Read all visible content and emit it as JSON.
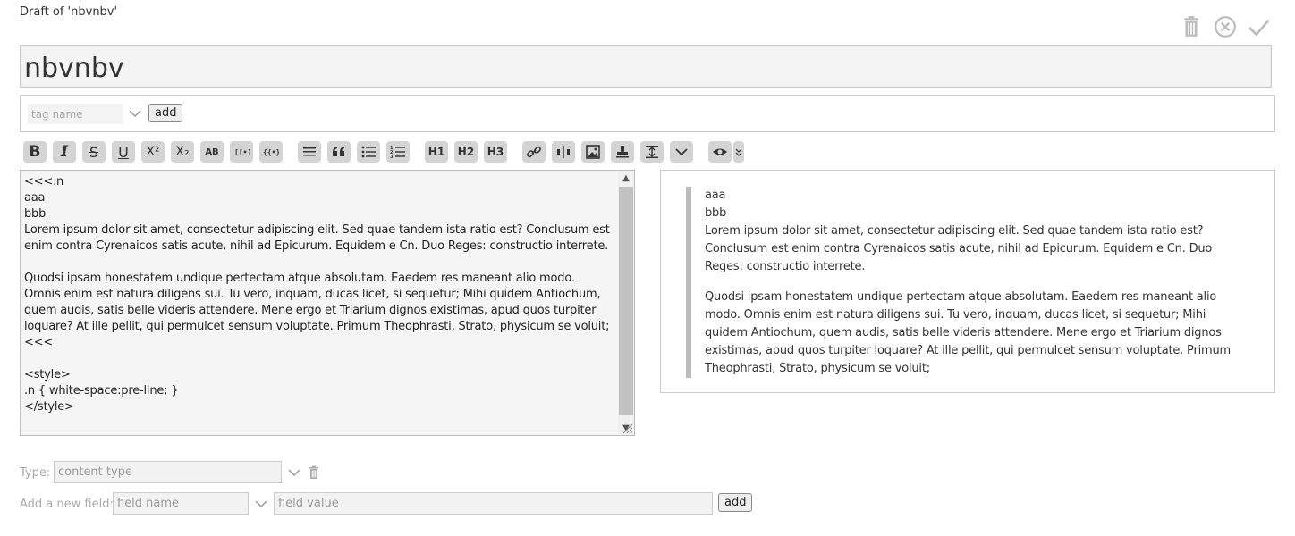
{
  "header": {
    "draft_title": "Draft of 'nbvnbv'",
    "icons": [
      "trash-icon",
      "cancel-icon",
      "check-icon"
    ]
  },
  "title": {
    "value": "nbvnbv"
  },
  "tags": {
    "placeholder": "tag name",
    "add_label": "add"
  },
  "toolbar": {
    "bold": "B",
    "italic": "I",
    "strike": "S",
    "underline": "U",
    "superscript": "X²",
    "subscript": "X₂",
    "smallcaps": "AB",
    "h1": "H1",
    "h2": "H2",
    "h3": "H3"
  },
  "editor": {
    "content": "<<<.n\naaa\nbbb\nLorem ipsum dolor sit amet, consectetur adipiscing elit. Sed quae tandem ista ratio est? Conclusum est enim contra Cyrenaicos satis acute, nihil ad Epicurum. Equidem e Cn. Duo Reges: constructio interrete.\n\nQuodsi ipsam honestatem undique pertectam atque absolutam. Eaedem res maneant alio modo. Omnis enim est natura diligens sui. Tu vero, inquam, ducas licet, si sequetur; Mihi quidem Antiochum, quem audis, satis belle videris attendere. Mene ergo et Triarium dignos existimas, apud quos turpiter loquare? At ille pellit, qui permulcet sensum voluptate. Primum Theophrasti, Strato, physicum se voluit;\n<<<\n\n<style>\n.n { white-space:pre-line; }\n</style>"
  },
  "preview": {
    "paragraph1": "aaa\nbbb\nLorem ipsum dolor sit amet, consectetur adipiscing elit. Sed quae tandem ista ratio est? Conclusum est enim contra Cyrenaicos satis acute, nihil ad Epicurum. Equidem e Cn. Duo Reges: constructio interrete.",
    "paragraph2": "Quodsi ipsam honestatem undique pertectam atque absolutam. Eaedem res maneant alio modo. Omnis enim est natura diligens sui. Tu vero, inquam, ducas licet, si sequetur; Mihi quidem Antiochum, quem audis, satis belle videris attendere. Mene ergo et Triarium dignos existimas, apud quos turpiter loquare? At ille pellit, qui permulcet sensum voluptate. Primum Theophrasti, Strato, physicum se voluit;"
  },
  "type_field": {
    "label": "Type:",
    "placeholder": "content type"
  },
  "new_field": {
    "label": "Add a new field:",
    "name_placeholder": "field name",
    "value_placeholder": "field value",
    "add_label": "add"
  }
}
